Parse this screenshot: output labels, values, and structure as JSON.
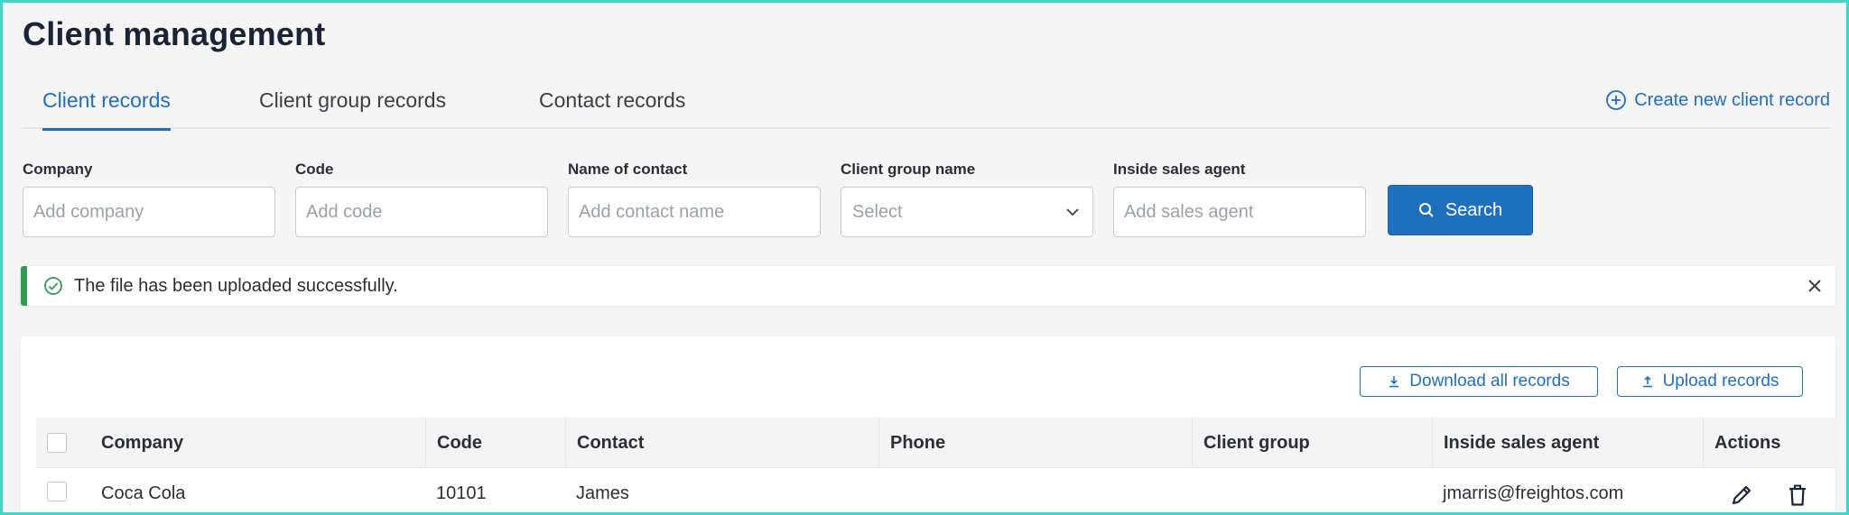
{
  "page": {
    "title": "Client management"
  },
  "tabs": [
    {
      "label": "Client records",
      "active": true
    },
    {
      "label": "Client group records",
      "active": false
    },
    {
      "label": "Contact records",
      "active": false
    }
  ],
  "create_link": {
    "label": "Create new client record",
    "icon": "plus-circle-icon"
  },
  "filters": {
    "company": {
      "label": "Company",
      "placeholder": "Add company",
      "value": ""
    },
    "code": {
      "label": "Code",
      "placeholder": "Add code",
      "value": ""
    },
    "contact": {
      "label": "Name of contact",
      "placeholder": "Add contact name",
      "value": ""
    },
    "client_group": {
      "label": "Client group name",
      "placeholder": "Select",
      "value": ""
    },
    "sales_agent": {
      "label": "Inside sales agent",
      "placeholder": "Add sales agent",
      "value": ""
    },
    "search_label": "Search"
  },
  "alert": {
    "message": "The file has been uploaded successfully.",
    "type": "success"
  },
  "toolbar": {
    "download_label": "Download all records",
    "upload_label": "Upload records"
  },
  "table": {
    "columns": [
      "Company",
      "Code",
      "Contact",
      "Phone",
      "Client group",
      "Inside sales agent",
      "Actions"
    ],
    "rows": [
      {
        "company": "Coca Cola",
        "code": "10101",
        "contact": "James",
        "phone": "",
        "client_group": "",
        "sales_agent": "jmarris@freightos.com"
      }
    ]
  },
  "colors": {
    "accent": "#1f6fbf",
    "success": "#2e9d57",
    "frame": "#3dd6c8"
  }
}
